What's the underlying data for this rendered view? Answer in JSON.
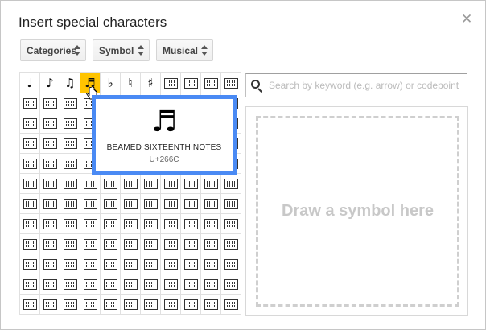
{
  "dialog": {
    "title": "Insert special characters",
    "close_icon": "close-icon"
  },
  "dropdowns": [
    {
      "label": "Categories"
    },
    {
      "label": "Symbol"
    },
    {
      "label": "Musical"
    }
  ],
  "grid": {
    "columns": 11,
    "rows": 12,
    "first_row": [
      "♩",
      "♪",
      "♫",
      "♬",
      "♭",
      "♮",
      "♯"
    ],
    "highlighted_symbol": "♬",
    "unrendered_icon": "missing-glyph-box-icon"
  },
  "tooltip": {
    "glyph": "♬",
    "name": "BEAMED SIXTEENTH NOTES",
    "codepoint": "U+266C"
  },
  "search": {
    "placeholder": "Search by keyword (e.g. arrow) or codepoint",
    "value": ""
  },
  "draw": {
    "label": "Draw a symbol here"
  },
  "colors": {
    "highlight": "#ffc400",
    "tooltip_border": "#4a8af4"
  }
}
